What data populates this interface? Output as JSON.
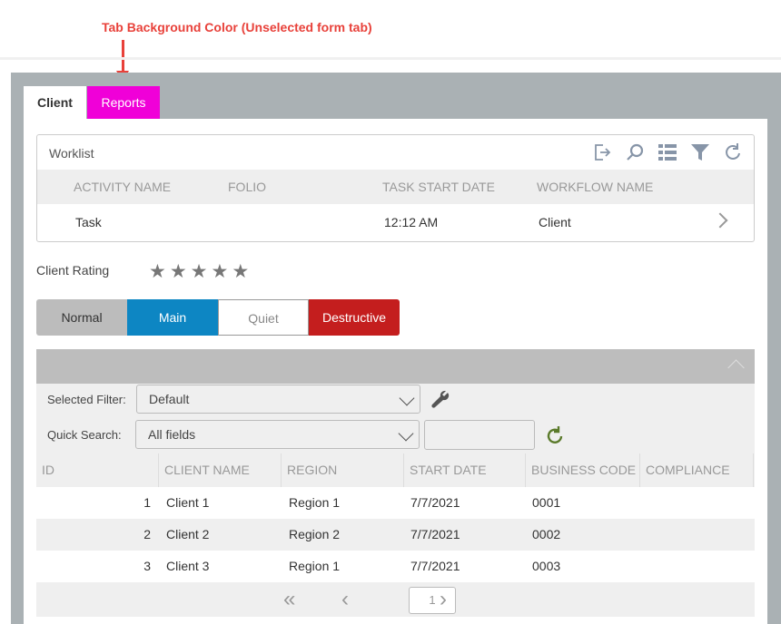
{
  "annotation": "Tab Background Color (Unselected form tab)",
  "tabs": [
    {
      "label": "Client"
    },
    {
      "label": "Reports"
    }
  ],
  "worklist": {
    "title": "Worklist",
    "columns": [
      "ACTIVITY NAME",
      "FOLIO",
      "TASK START DATE",
      "WORKFLOW NAME"
    ],
    "rows": [
      {
        "activity": "Task",
        "folio": "",
        "start": "12:12 AM",
        "workflow": "Client"
      }
    ]
  },
  "rating": {
    "label": "Client Rating",
    "value": 0,
    "max": 5
  },
  "buttons": {
    "normal": "Normal",
    "main": "Main",
    "quiet": "Quiet",
    "destructive": "Destructive"
  },
  "grid": {
    "filter_label": "Selected Filter:",
    "filter_value": "Default",
    "search_label": "Quick Search:",
    "search_value": "All fields",
    "search_text": "",
    "columns": [
      "ID",
      "CLIENT NAME",
      "REGION",
      "START DATE",
      "BUSINESS CODE",
      "COMPLIANCE"
    ],
    "rows": [
      {
        "id": "1",
        "name": "Client 1",
        "region": "Region 1",
        "date": "7/7/2021",
        "code": "0001",
        "compliance": ""
      },
      {
        "id": "2",
        "name": "Client 2",
        "region": "Region 2",
        "date": "7/7/2021",
        "code": "0002",
        "compliance": ""
      },
      {
        "id": "3",
        "name": "Client 3",
        "region": "Region 1",
        "date": "7/7/2021",
        "code": "0003",
        "compliance": ""
      }
    ],
    "page": "1"
  },
  "colors": {
    "tab_unselected": "#f000d8",
    "main": "#0d86c3",
    "destructive": "#c41e1e"
  }
}
